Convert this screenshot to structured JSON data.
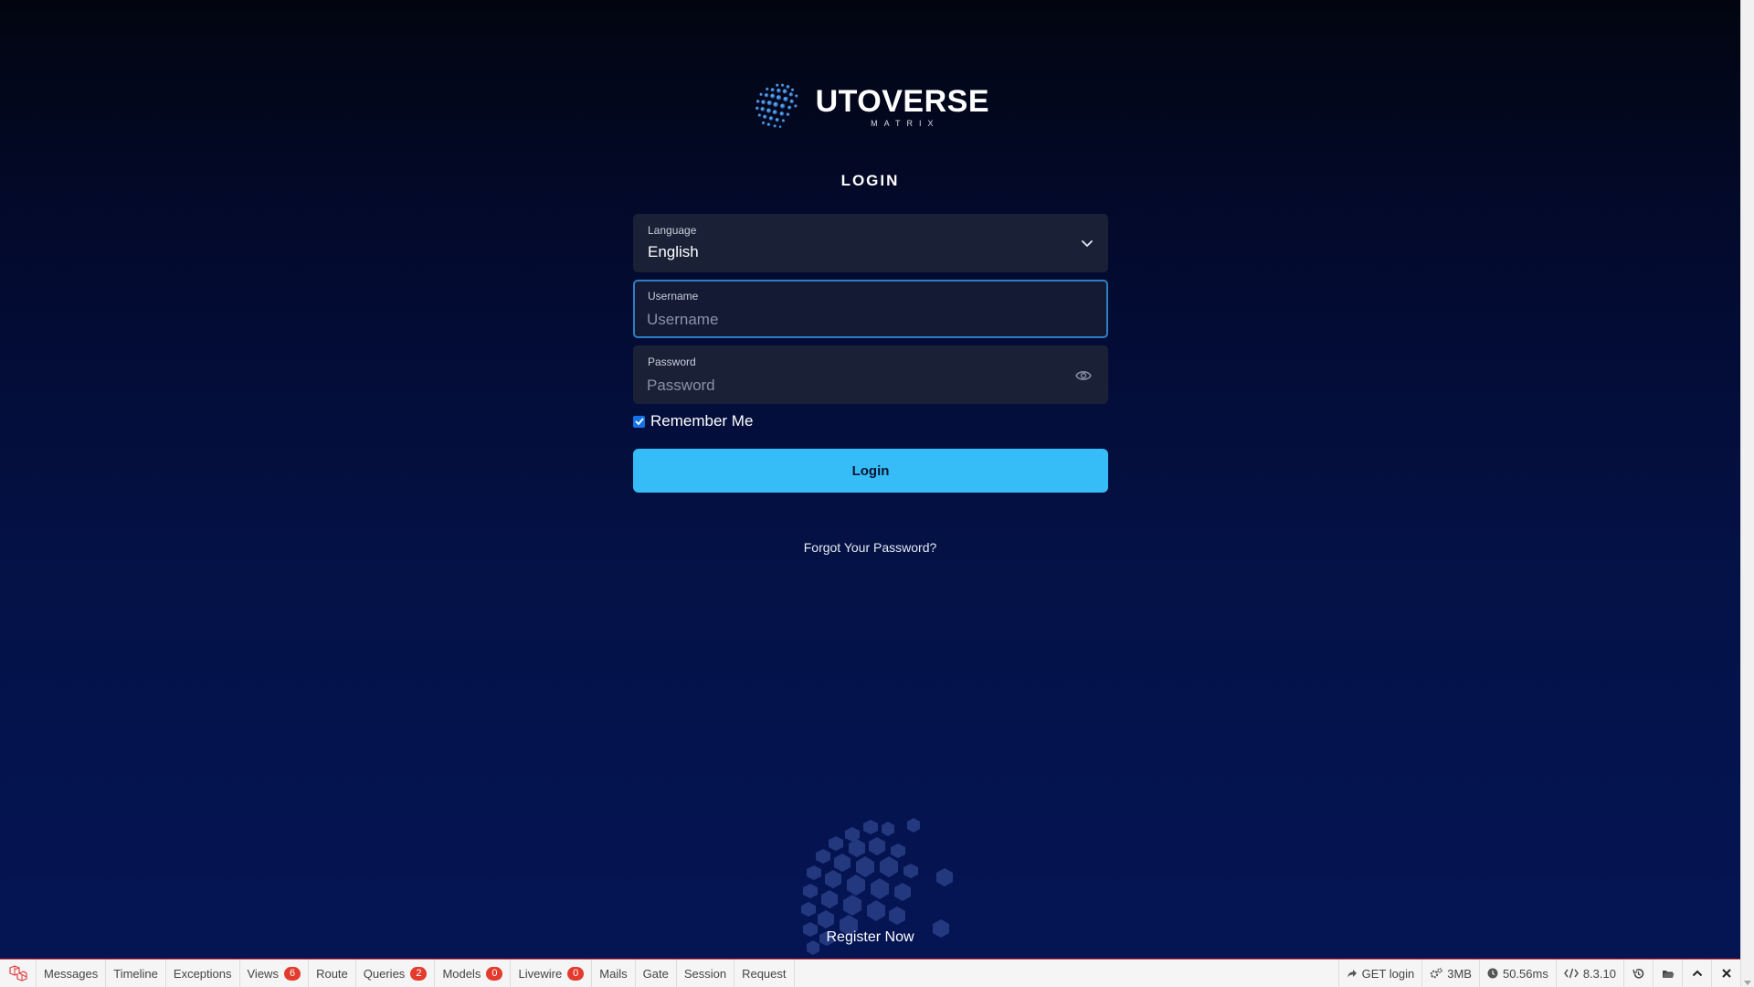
{
  "brand": {
    "name": "UTOVERSE",
    "tagline": "MATRIX"
  },
  "page_title": "LOGIN",
  "form": {
    "language": {
      "label": "Language",
      "value": "English"
    },
    "username": {
      "label": "Username",
      "placeholder": "Username",
      "value": ""
    },
    "password": {
      "label": "Password",
      "placeholder": "Password",
      "value": ""
    },
    "remember": {
      "label": "Remember Me",
      "checked": true
    },
    "submit_label": "Login",
    "forgot_label": "Forgot Your Password?"
  },
  "register_label": "Register Now",
  "colors": {
    "accent": "#36bdf7",
    "field_bg": "#1a2136",
    "focus": "#2d7fc4",
    "badge": "#e33b2e"
  },
  "debugbar": {
    "tabs": [
      {
        "label": "Messages"
      },
      {
        "label": "Timeline"
      },
      {
        "label": "Exceptions"
      },
      {
        "label": "Views",
        "badge": "6"
      },
      {
        "label": "Route"
      },
      {
        "label": "Queries",
        "badge": "2"
      },
      {
        "label": "Models",
        "badge": "0"
      },
      {
        "label": "Livewire",
        "badge": "0"
      },
      {
        "label": "Mails"
      },
      {
        "label": "Gate"
      },
      {
        "label": "Session"
      },
      {
        "label": "Request"
      }
    ],
    "request": "GET login",
    "memory": "3MB",
    "time": "50.56ms",
    "php_version": "8.3.10",
    "icons": [
      "laravel-icon",
      "share-icon",
      "cogs-icon",
      "clock-icon",
      "code-icon",
      "history-icon",
      "folder-icon",
      "chevron-up-icon",
      "close-icon"
    ]
  }
}
